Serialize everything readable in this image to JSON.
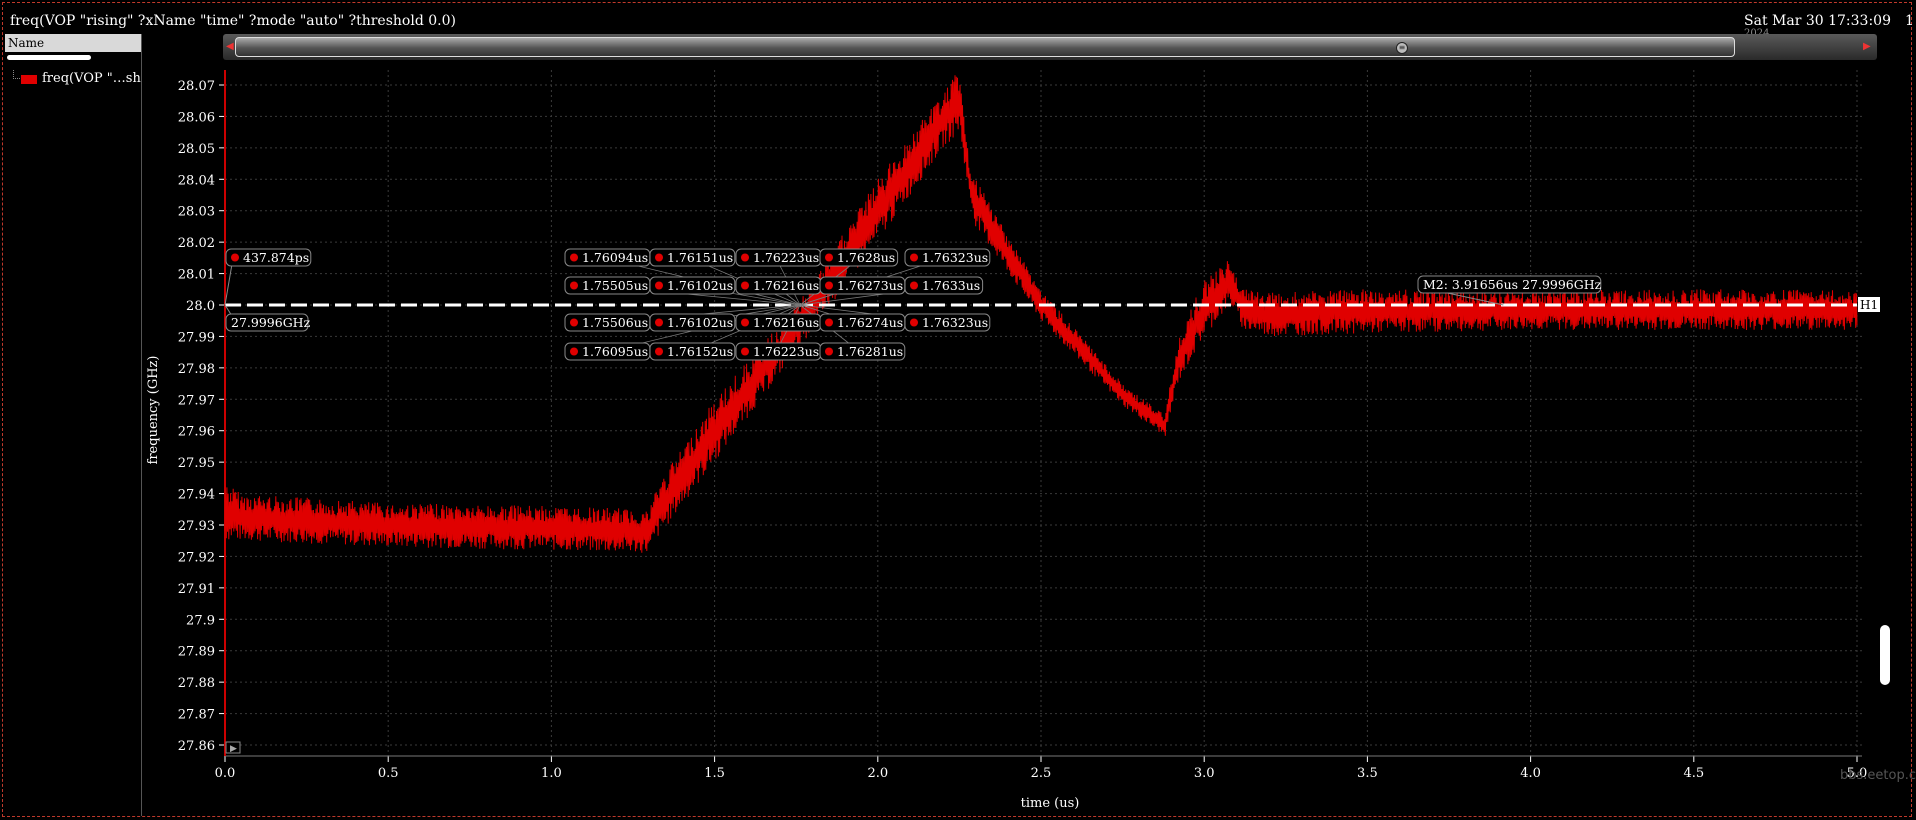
{
  "window": {
    "title": "freq(VOP \"rising\" ?xName \"time\" ?mode \"auto\" ?threshold 0.0)",
    "date": "Sat Mar 30 17:33:09",
    "date_line2": "2024",
    "corner": "1"
  },
  "sidebar": {
    "header": "Name",
    "signal_label": "freq(VOP \"…sholc"
  },
  "plot": {
    "xlabel": "time (us)",
    "ylabel": "frequency (GHz)",
    "hline_label": "H1",
    "marker_label": "M2: 3.91656us 27.9996GHz",
    "left_top_label": "437.874ps",
    "left_bottom_label": "27.9996GHz",
    "cross_rows": [
      [
        "1.76094us",
        "1.76151us",
        "1.76223us",
        "1.7628us",
        "1.76323us"
      ],
      [
        "1.75505us",
        "1.76102us",
        "1.76216us",
        "1.76273us",
        "1.7633us"
      ],
      [
        "1.75506us",
        "1.76102us",
        "1.76216us",
        "1.76274us",
        "1.76323us"
      ],
      [
        "1.76095us",
        "1.76152us",
        "1.76223us",
        "1.76281us"
      ]
    ]
  },
  "watermark": "bbs.eetop.cn",
  "colors": {
    "trace": "#e00000",
    "background": "#000000",
    "grid": "#3a3a3a"
  },
  "chart_data": {
    "type": "line",
    "title": "",
    "xlabel": "time (us)",
    "ylabel": "frequency (GHz)",
    "xlim": [
      0,
      5.05
    ],
    "ylim": [
      27.855,
      28.075
    ],
    "xticks": [
      "0.0",
      "0.5",
      "1.0",
      "1.5",
      "2.0",
      "2.5",
      "3.0",
      "3.5",
      "4.0",
      "4.5",
      "5.0"
    ],
    "yticks": [
      "28.07",
      "28.06",
      "28.05",
      "28.04",
      "28.03",
      "28.02",
      "28.01",
      "28.0",
      "27.99",
      "27.98",
      "27.97",
      "27.96",
      "27.95",
      "27.94",
      "27.93",
      "27.92",
      "27.91",
      "27.9",
      "27.89",
      "27.88",
      "27.87",
      "27.86"
    ],
    "grid": true,
    "legend": "left-panel",
    "hline": 28.0,
    "series": [
      {
        "name": "freq(VOP \"…sholc",
        "envelope_x": [
          0,
          0.05,
          0.5,
          1.0,
          1.3,
          1.32,
          1.5,
          1.75,
          2.0,
          2.2,
          2.25,
          2.28,
          2.3,
          2.5,
          2.75,
          2.88,
          2.92,
          3.0,
          3.08,
          3.12,
          3.2,
          3.5,
          4.0,
          5.0
        ],
        "envelope_low": [
          27.925,
          27.925,
          27.923,
          27.922,
          27.921,
          27.925,
          27.95,
          27.985,
          28.02,
          28.05,
          28.055,
          28.035,
          28.025,
          27.995,
          27.968,
          27.958,
          27.975,
          27.99,
          28.0,
          27.992,
          27.99,
          27.991,
          27.992,
          27.992
        ],
        "envelope_high": [
          27.944,
          27.94,
          27.937,
          27.936,
          27.935,
          27.942,
          27.97,
          28.0,
          28.04,
          28.068,
          28.075,
          28.045,
          28.04,
          28.005,
          27.975,
          27.965,
          27.99,
          28.008,
          28.015,
          28.005,
          28.004,
          28.005,
          28.005,
          28.005
        ]
      }
    ]
  }
}
